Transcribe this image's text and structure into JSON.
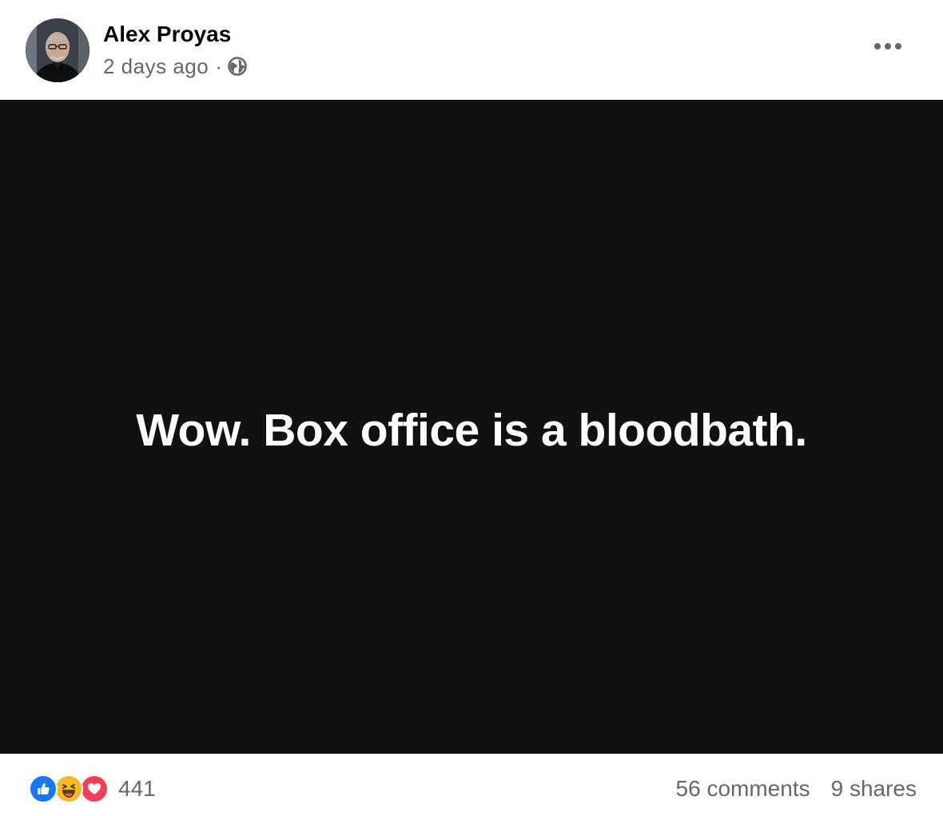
{
  "post": {
    "author": "Alex Proyas",
    "timestamp": "2 days ago",
    "separator": "·",
    "privacy_icon": "globe-icon",
    "menu_icon": "more-horizontal-icon",
    "media_text": "Wow. Box office is a bloodbath.",
    "media_background": "#111111"
  },
  "reactions": {
    "types": [
      "like",
      "haha",
      "love"
    ],
    "count": "441"
  },
  "engagement": {
    "comments": "56 comments",
    "shares": "9 shares"
  },
  "colors": {
    "like": "#1877f2",
    "haha": "#f7b928",
    "love": "#f33e58",
    "secondary_text": "#65676b"
  }
}
